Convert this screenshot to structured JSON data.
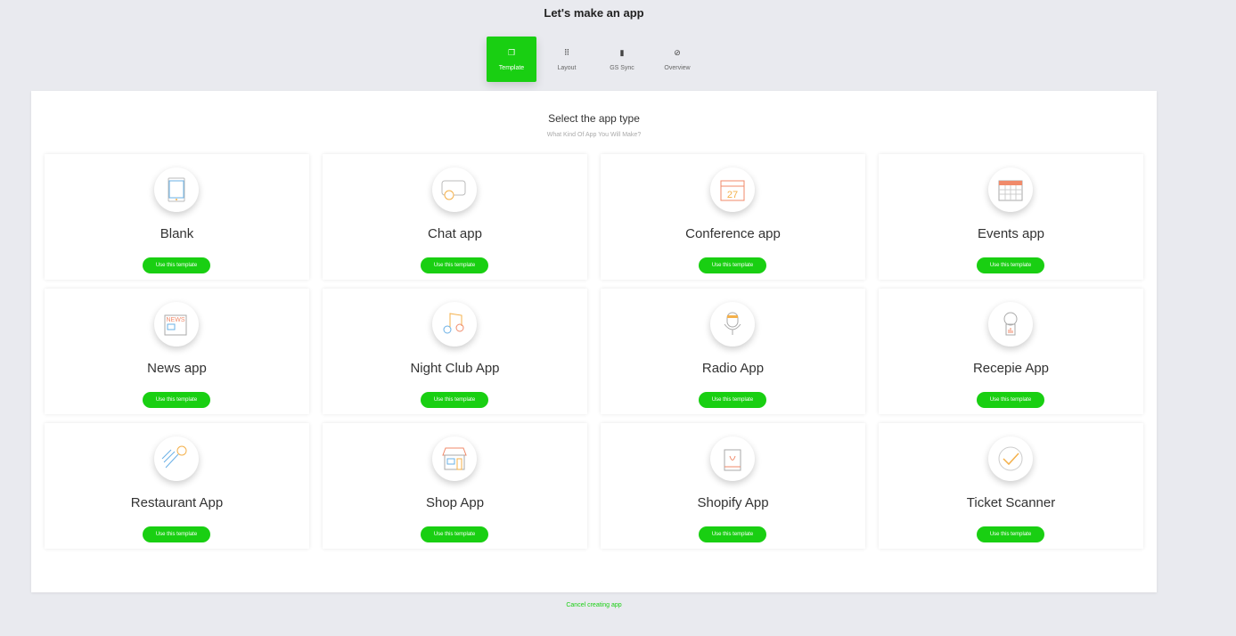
{
  "header": {
    "title": "Let's make an app"
  },
  "steps": [
    {
      "label": "Template",
      "icon": "template-icon",
      "active": true
    },
    {
      "label": "Layout",
      "icon": "grid-icon"
    },
    {
      "label": "GS Sync",
      "icon": "file-icon"
    },
    {
      "label": "Overview",
      "icon": "check-circle-icon"
    }
  ],
  "panel": {
    "heading": "Select the app type",
    "subheading": "What Kind Of App You Will Make?"
  },
  "templates": [
    {
      "name": "Blank",
      "icon": "tablet-icon"
    },
    {
      "name": "Chat app",
      "icon": "chat-bubble-icon"
    },
    {
      "name": "Conference app",
      "icon": "calendar-27-icon"
    },
    {
      "name": "Events app",
      "icon": "calendar-grid-icon"
    },
    {
      "name": "News app",
      "icon": "newspaper-icon"
    },
    {
      "name": "Night Club App",
      "icon": "music-note-icon"
    },
    {
      "name": "Radio App",
      "icon": "microphone-icon"
    },
    {
      "name": "Recepie App",
      "icon": "chef-hat-icon"
    },
    {
      "name": "Restaurant App",
      "icon": "fork-icon"
    },
    {
      "name": "Shop App",
      "icon": "storefront-icon"
    },
    {
      "name": "Shopify App",
      "icon": "shopping-bag-icon"
    },
    {
      "name": "Ticket Scanner",
      "icon": "checkmark-icon"
    }
  ],
  "button_label": "Use this template",
  "cancel_label": "Cancel creating app",
  "colors": {
    "accent": "#19cf12"
  }
}
